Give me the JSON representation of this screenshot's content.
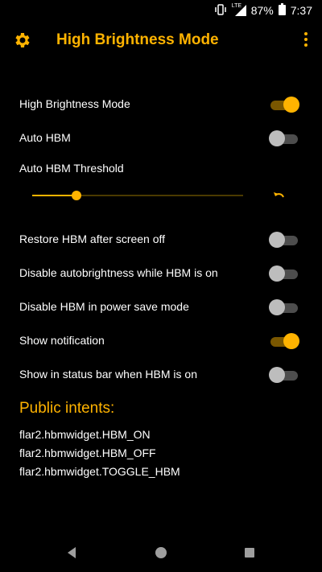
{
  "status_bar": {
    "network": "LTE",
    "battery": "87%",
    "time": "7:37"
  },
  "app_bar": {
    "title": "High Brightness Mode"
  },
  "settings": [
    {
      "label": "High Brightness Mode",
      "on": true
    },
    {
      "label": "Auto HBM",
      "on": false
    }
  ],
  "threshold": {
    "label": "Auto HBM Threshold",
    "level_fraction": 0.21
  },
  "settings2": [
    {
      "label": "Restore HBM after screen off",
      "on": false
    },
    {
      "label": "Disable autobrightness while HBM is on",
      "on": false
    },
    {
      "label": "Disable HBM in power save mode",
      "on": false
    },
    {
      "label": "Show notification",
      "on": true
    },
    {
      "label": "Show in status bar when HBM is on",
      "on": false
    }
  ],
  "public_intents": {
    "title": "Public intents:",
    "items": [
      "flar2.hbmwidget.HBM_ON",
      "flar2.hbmwidget.HBM_OFF",
      "flar2.hbmwidget.TOGGLE_HBM"
    ]
  },
  "colors": {
    "accent": "#ffb300",
    "background": "#000000"
  }
}
